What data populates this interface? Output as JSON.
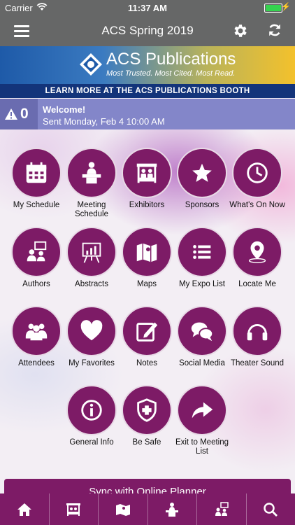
{
  "status_bar": {
    "carrier": "Carrier",
    "time": "11:37 AM"
  },
  "nav": {
    "title": "ACS Spring 2019",
    "menu_icon": "hamburger-menu-icon",
    "settings_icon": "gear-icon",
    "refresh_icon": "refresh-icon"
  },
  "banner": {
    "brand": "ACS Publications",
    "tagline": "Most Trusted. Most Cited. Most Read.",
    "cta": "LEARN MORE AT THE ACS PUBLICATIONS BOOTH"
  },
  "alert": {
    "count": "0",
    "title": "Welcome!",
    "subtitle": "Sent Monday, Feb 4 10:00 AM"
  },
  "tiles": [
    {
      "label": "My Schedule",
      "icon": "calendar-icon"
    },
    {
      "label": "Meeting Schedule",
      "icon": "speaker-podium-icon"
    },
    {
      "label": "Exhibitors",
      "icon": "booth-icon"
    },
    {
      "label": "Sponsors",
      "icon": "star-icon"
    },
    {
      "label": "What's On Now",
      "icon": "clock-icon"
    },
    {
      "label": "Authors",
      "icon": "people-presentation-icon"
    },
    {
      "label": "Abstracts",
      "icon": "chart-easel-icon"
    },
    {
      "label": "Maps",
      "icon": "map-icon"
    },
    {
      "label": "My Expo List",
      "icon": "list-icon"
    },
    {
      "label": "Locate Me",
      "icon": "location-pin-icon"
    },
    {
      "label": "Attendees",
      "icon": "group-icon"
    },
    {
      "label": "My Favorites",
      "icon": "heart-icon"
    },
    {
      "label": "Notes",
      "icon": "note-edit-icon"
    },
    {
      "label": "Social Media",
      "icon": "chat-bubbles-icon"
    },
    {
      "label": "Theater Sound",
      "icon": "headphones-icon"
    },
    {
      "label": "General Info",
      "icon": "info-icon"
    },
    {
      "label": "Be Safe",
      "icon": "shield-plus-icon"
    },
    {
      "label": "Exit to Meeting List",
      "icon": "share-arrow-icon"
    }
  ],
  "sync_button": {
    "label": "Sync with Online Planner"
  },
  "tabbar": [
    {
      "icon": "home-icon"
    },
    {
      "icon": "booth-icon"
    },
    {
      "icon": "map-icon"
    },
    {
      "icon": "speaker-podium-icon"
    },
    {
      "icon": "people-presentation-icon"
    },
    {
      "icon": "search-icon"
    }
  ],
  "colors": {
    "accent": "#7d1b66",
    "nav": "#666767",
    "alert": "#8386c9"
  }
}
